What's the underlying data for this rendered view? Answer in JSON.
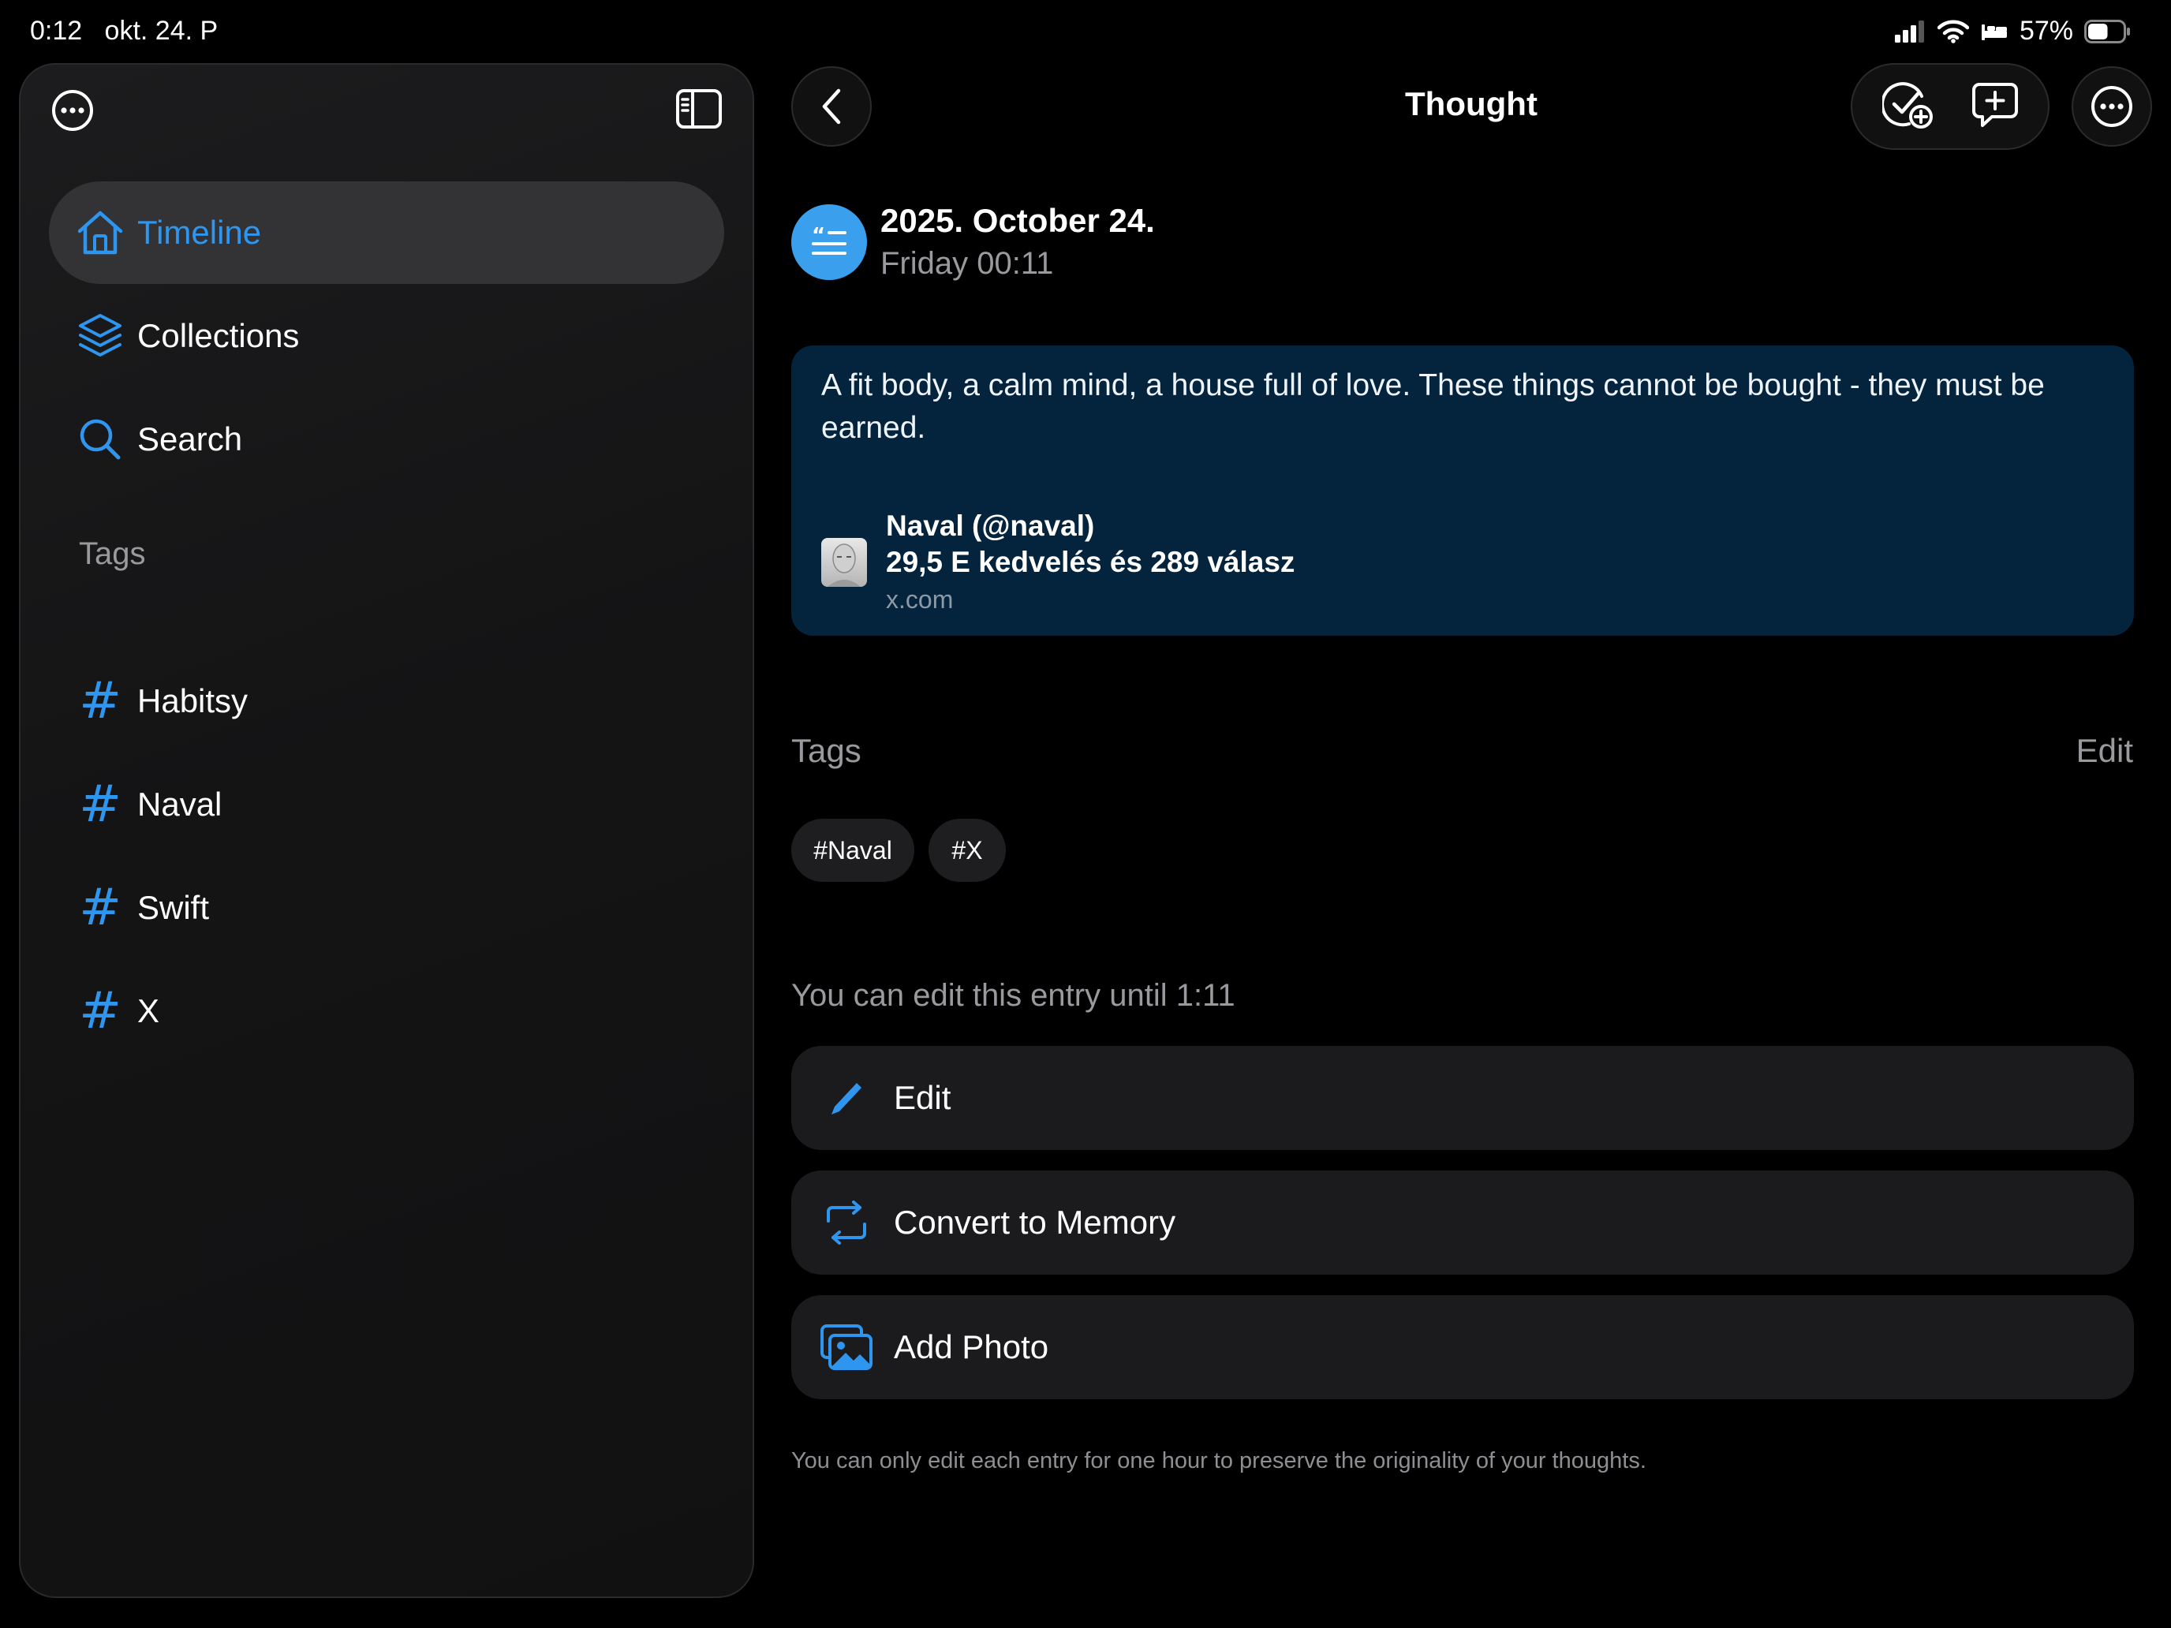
{
  "status_bar": {
    "time": "0:12",
    "date": "okt. 24. P",
    "battery": "57%",
    "battery_level": 0.57
  },
  "sidebar": {
    "nav": [
      {
        "label": "Timeline",
        "icon": "house-icon",
        "selected": true
      },
      {
        "label": "Collections",
        "icon": "layers-icon",
        "selected": false
      },
      {
        "label": "Search",
        "icon": "search-icon",
        "selected": false
      }
    ],
    "tags_header": "Tags",
    "tags": [
      {
        "label": "Habitsy",
        "icon": "hash-icon"
      },
      {
        "label": "Naval",
        "icon": "hash-icon"
      },
      {
        "label": "Swift",
        "icon": "hash-icon"
      },
      {
        "label": "X",
        "icon": "hash-icon"
      }
    ]
  },
  "header": {
    "title": "Thought"
  },
  "entry": {
    "date": "2025. October 24.",
    "weekday_time": "Friday 00:11",
    "quote": "A fit body, a calm mind, a house full of love. These things cannot be bought - they must be earned.",
    "link": {
      "name": "Naval (@naval)",
      "stats": "29,5 E kedvelés és 289 válasz",
      "domain": "x.com"
    }
  },
  "tags_section": {
    "title": "Tags",
    "edit_label": "Edit",
    "chips": [
      "#Naval",
      "#X"
    ]
  },
  "edit_section": {
    "notice": "You can edit this entry until 1:11",
    "actions": [
      {
        "label": "Edit",
        "icon": "pencil-icon"
      },
      {
        "label": "Convert to Memory",
        "icon": "convert-icon"
      },
      {
        "label": "Add Photo",
        "icon": "photo-icon"
      }
    ],
    "footnote": "You can only edit each entry for one hour to preserve the originality of your thoughts."
  },
  "colors": {
    "accent": "#2f96f0",
    "quote_card": "#04243e",
    "background": "#000000",
    "row_background": "#1b1b1d"
  }
}
